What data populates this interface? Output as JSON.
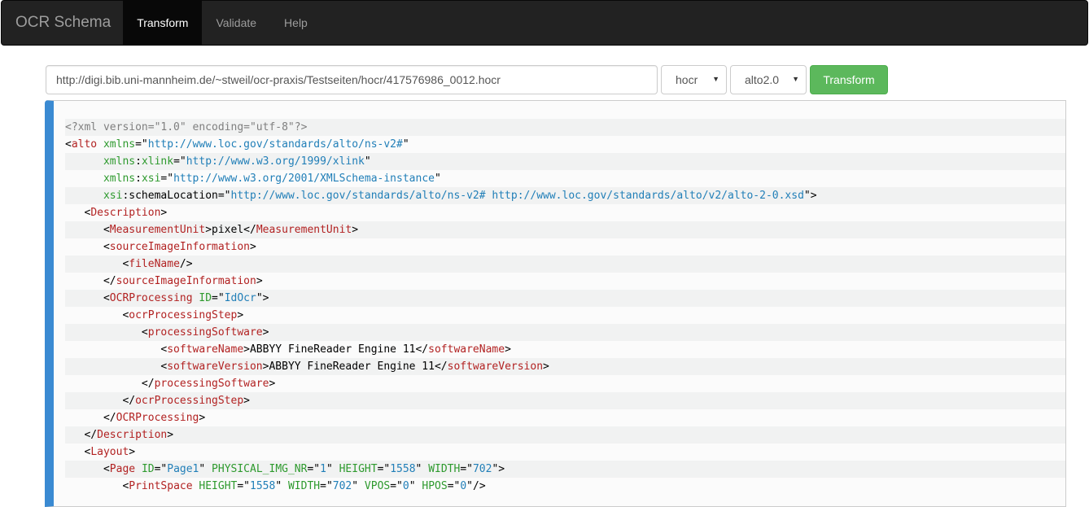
{
  "navbar": {
    "brand": "OCR Schema",
    "items": [
      {
        "label": "Transform",
        "active": true
      },
      {
        "label": "Validate",
        "active": false
      },
      {
        "label": "Help",
        "active": false
      }
    ]
  },
  "form": {
    "url_value": "http://digi.bib.uni-mannheim.de/~stweil/ocr-praxis/Testseiten/hocr/417576986_0012.hocr",
    "from_format": "hocr",
    "to_format": "alto2.0",
    "transform_label": "Transform"
  },
  "code": {
    "lines": [
      {
        "indent": "",
        "segs": [
          [
            "decl",
            "<?xml version=\"1.0\" encoding=\"utf-8\"?>"
          ]
        ]
      },
      {
        "indent": "",
        "segs": [
          [
            "punc",
            "<"
          ],
          [
            "tag",
            "alto"
          ],
          [
            "punc",
            " "
          ],
          [
            "attr",
            "xmlns"
          ],
          [
            "punc",
            "=\""
          ],
          [
            "val",
            "http://www.loc.gov/standards/alto/ns-v2#"
          ],
          [
            "punc",
            "\""
          ]
        ]
      },
      {
        "indent": "      ",
        "segs": [
          [
            "attr",
            "xmlns"
          ],
          [
            "punc",
            ":"
          ],
          [
            "attr",
            "xlink"
          ],
          [
            "punc",
            "=\""
          ],
          [
            "val",
            "http://www.w3.org/1999/xlink"
          ],
          [
            "punc",
            "\""
          ]
        ]
      },
      {
        "indent": "      ",
        "segs": [
          [
            "attr",
            "xmlns"
          ],
          [
            "punc",
            ":"
          ],
          [
            "attr",
            "xsi"
          ],
          [
            "punc",
            "=\""
          ],
          [
            "val",
            "http://www.w3.org/2001/XMLSchema-instance"
          ],
          [
            "punc",
            "\""
          ]
        ]
      },
      {
        "indent": "      ",
        "segs": [
          [
            "attr",
            "xsi"
          ],
          [
            "punc",
            ":"
          ],
          [
            "punc",
            "schemaLocation"
          ],
          [
            "punc",
            "=\""
          ],
          [
            "val",
            "http://www.loc.gov/standards/alto/ns-v2# http://www.loc.gov/standards/alto/v2/alto-2-0.xsd"
          ],
          [
            "punc",
            "\">"
          ]
        ]
      },
      {
        "indent": "   ",
        "segs": [
          [
            "punc",
            "<"
          ],
          [
            "tag",
            "Description"
          ],
          [
            "punc",
            ">"
          ]
        ]
      },
      {
        "indent": "      ",
        "segs": [
          [
            "punc",
            "<"
          ],
          [
            "tag",
            "MeasurementUnit"
          ],
          [
            "punc",
            ">pixel</"
          ],
          [
            "tag",
            "MeasurementUnit"
          ],
          [
            "punc",
            ">"
          ]
        ]
      },
      {
        "indent": "      ",
        "segs": [
          [
            "punc",
            "<"
          ],
          [
            "tag",
            "sourceImageInformation"
          ],
          [
            "punc",
            ">"
          ]
        ]
      },
      {
        "indent": "         ",
        "segs": [
          [
            "punc",
            "<"
          ],
          [
            "tag",
            "fileName"
          ],
          [
            "punc",
            "/>"
          ]
        ]
      },
      {
        "indent": "      ",
        "segs": [
          [
            "punc",
            "</"
          ],
          [
            "tag",
            "sourceImageInformation"
          ],
          [
            "punc",
            ">"
          ]
        ]
      },
      {
        "indent": "      ",
        "segs": [
          [
            "punc",
            "<"
          ],
          [
            "tag",
            "OCRProcessing"
          ],
          [
            "punc",
            " "
          ],
          [
            "attr",
            "ID"
          ],
          [
            "punc",
            "=\""
          ],
          [
            "val",
            "IdOcr"
          ],
          [
            "punc",
            "\">"
          ]
        ]
      },
      {
        "indent": "         ",
        "segs": [
          [
            "punc",
            "<"
          ],
          [
            "tag",
            "ocrProcessingStep"
          ],
          [
            "punc",
            ">"
          ]
        ]
      },
      {
        "indent": "            ",
        "segs": [
          [
            "punc",
            "<"
          ],
          [
            "tag",
            "processingSoftware"
          ],
          [
            "punc",
            ">"
          ]
        ]
      },
      {
        "indent": "               ",
        "segs": [
          [
            "punc",
            "<"
          ],
          [
            "tag",
            "softwareName"
          ],
          [
            "punc",
            ">ABBYY FineReader Engine 11</"
          ],
          [
            "tag",
            "softwareName"
          ],
          [
            "punc",
            ">"
          ]
        ]
      },
      {
        "indent": "               ",
        "segs": [
          [
            "punc",
            "<"
          ],
          [
            "tag",
            "softwareVersion"
          ],
          [
            "punc",
            ">ABBYY FineReader Engine 11</"
          ],
          [
            "tag",
            "softwareVersion"
          ],
          [
            "punc",
            ">"
          ]
        ]
      },
      {
        "indent": "            ",
        "segs": [
          [
            "punc",
            "</"
          ],
          [
            "tag",
            "processingSoftware"
          ],
          [
            "punc",
            ">"
          ]
        ]
      },
      {
        "indent": "         ",
        "segs": [
          [
            "punc",
            "</"
          ],
          [
            "tag",
            "ocrProcessingStep"
          ],
          [
            "punc",
            ">"
          ]
        ]
      },
      {
        "indent": "      ",
        "segs": [
          [
            "punc",
            "</"
          ],
          [
            "tag",
            "OCRProcessing"
          ],
          [
            "punc",
            ">"
          ]
        ]
      },
      {
        "indent": "   ",
        "segs": [
          [
            "punc",
            "</"
          ],
          [
            "tag",
            "Description"
          ],
          [
            "punc",
            ">"
          ]
        ]
      },
      {
        "indent": "   ",
        "segs": [
          [
            "punc",
            "<"
          ],
          [
            "tag",
            "Layout"
          ],
          [
            "punc",
            ">"
          ]
        ]
      },
      {
        "indent": "      ",
        "segs": [
          [
            "punc",
            "<"
          ],
          [
            "tag",
            "Page"
          ],
          [
            "punc",
            " "
          ],
          [
            "attr",
            "ID"
          ],
          [
            "punc",
            "=\""
          ],
          [
            "val",
            "Page1"
          ],
          [
            "punc",
            "\" "
          ],
          [
            "attr",
            "PHYSICAL_IMG_NR"
          ],
          [
            "punc",
            "=\""
          ],
          [
            "val",
            "1"
          ],
          [
            "punc",
            "\" "
          ],
          [
            "attr",
            "HEIGHT"
          ],
          [
            "punc",
            "=\""
          ],
          [
            "val",
            "1558"
          ],
          [
            "punc",
            "\" "
          ],
          [
            "attr",
            "WIDTH"
          ],
          [
            "punc",
            "=\""
          ],
          [
            "val",
            "702"
          ],
          [
            "punc",
            "\">"
          ]
        ]
      },
      {
        "indent": "         ",
        "segs": [
          [
            "punc",
            "<"
          ],
          [
            "tag",
            "PrintSpace"
          ],
          [
            "punc",
            " "
          ],
          [
            "attr",
            "HEIGHT"
          ],
          [
            "punc",
            "=\""
          ],
          [
            "val",
            "1558"
          ],
          [
            "punc",
            "\" "
          ],
          [
            "attr",
            "WIDTH"
          ],
          [
            "punc",
            "=\""
          ],
          [
            "val",
            "702"
          ],
          [
            "punc",
            "\" "
          ],
          [
            "attr",
            "VPOS"
          ],
          [
            "punc",
            "=\""
          ],
          [
            "val",
            "0"
          ],
          [
            "punc",
            "\" "
          ],
          [
            "attr",
            "HPOS"
          ],
          [
            "punc",
            "=\""
          ],
          [
            "val",
            "0"
          ],
          [
            "punc",
            "\"/>"
          ]
        ]
      }
    ]
  }
}
